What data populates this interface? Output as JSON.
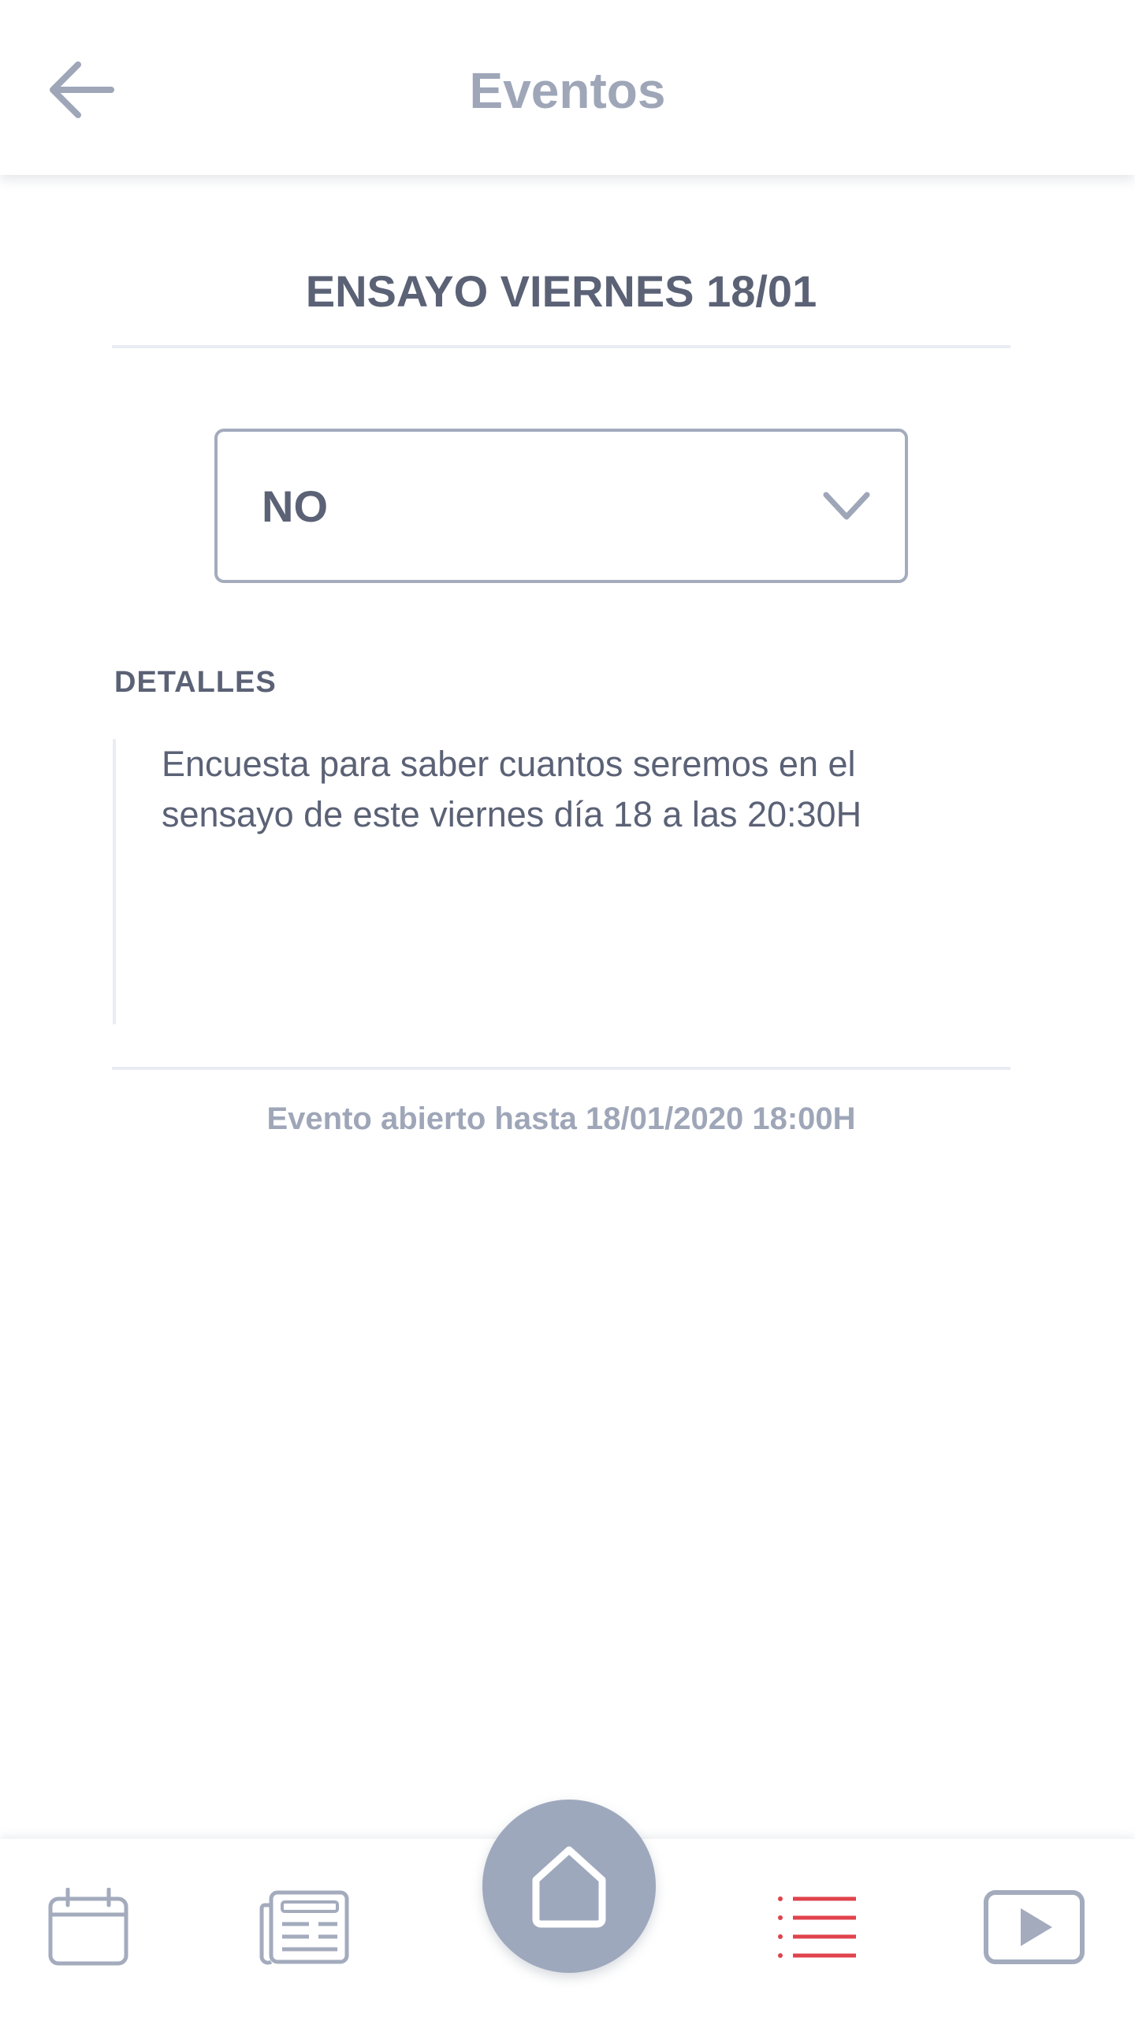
{
  "header": {
    "title": "Eventos",
    "back_icon": "arrow-left-icon"
  },
  "event": {
    "title": "ENSAYO VIERNES 18/01",
    "response_select": {
      "selected": "NO",
      "icon": "chevron-down-icon"
    },
    "details_label": "DETALLES",
    "details_text": "Encuesta para saber cuantos seremos en el\nsensayo de este viernes día 18 a las 20:30H",
    "deadline": "Evento abierto hasta 18/01/2020 18:00H"
  },
  "bottom_nav": {
    "items": [
      {
        "icon": "calendar-icon"
      },
      {
        "icon": "newspaper-icon"
      },
      {
        "icon": "home-icon"
      },
      {
        "icon": "list-icon",
        "active": true
      },
      {
        "icon": "play-icon"
      }
    ]
  },
  "colors": {
    "muted": "#9ea6b8",
    "text": "#5b6276",
    "accent_active": "#e0434c",
    "home_button": "#9ea8bd"
  }
}
